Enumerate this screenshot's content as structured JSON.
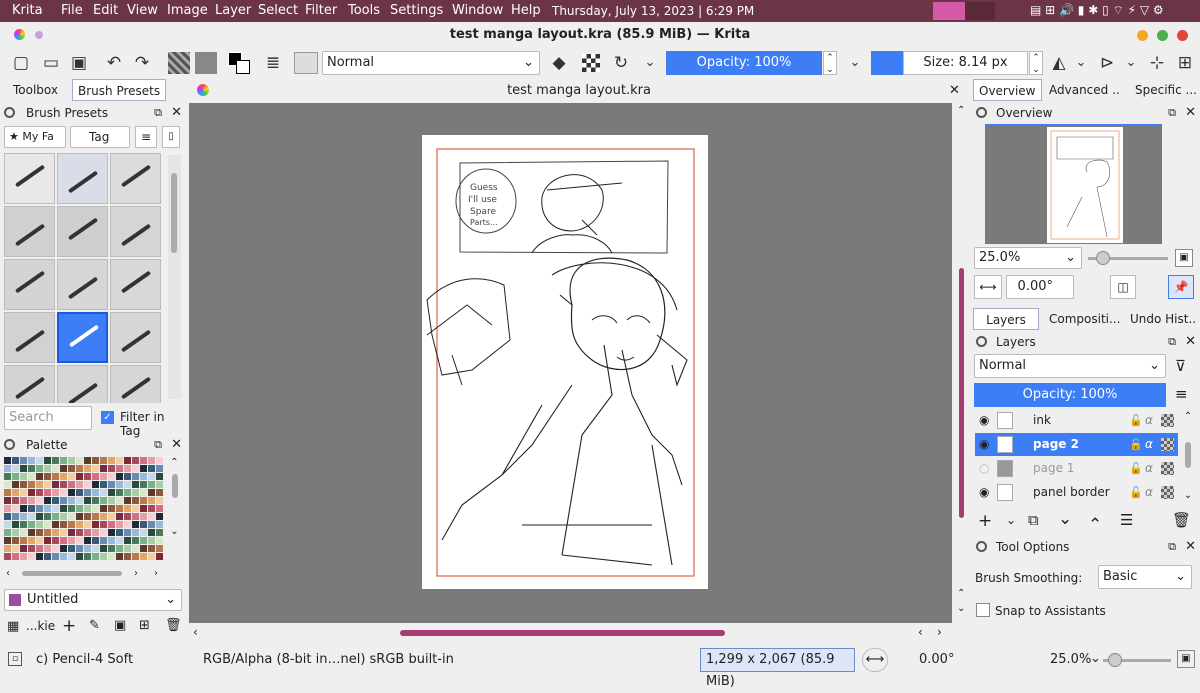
{
  "system_bar": {
    "app_menu": "Krita",
    "menus": [
      "File",
      "Edit",
      "View",
      "Image",
      "Layer",
      "Select",
      "Filter",
      "Tools",
      "Settings",
      "Window",
      "Help"
    ],
    "datetime": "Thursday, July 13, 2023 | 6:29 PM"
  },
  "window": {
    "title": "test manga layout.kra (85.9 MiB) — Krita"
  },
  "toolbar": {
    "blend_mode": "Normal",
    "opacity": "Opacity: 100%",
    "size": "Size: 8.14 px"
  },
  "left_dock": {
    "tabs": [
      "Toolbox",
      "Brush Presets"
    ],
    "brush_presets_title": "Brush Presets",
    "tag_filter": "★ My Fa",
    "tag_label": "Tag",
    "search_placeholder": "Search",
    "filter_in_tag": "Filter in Tag",
    "palette_title": "Palette",
    "palette_name": "Untitled",
    "palette_short": "...kie"
  },
  "document_tab": {
    "title": "test manga layout.kra"
  },
  "right_dock": {
    "top_tabs": [
      "Overview",
      "Advanced ...",
      "Specific ..."
    ],
    "overview_title": "Overview",
    "zoom": "25.0%",
    "rotation": "0.00°",
    "mid_tabs": [
      "Layers",
      "Compositi...",
      "Undo Hist..."
    ],
    "layers_title": "Layers",
    "layer_blend": "Normal",
    "layer_opacity": "Opacity:  100%",
    "layers": [
      {
        "name": "ink",
        "visible": true,
        "active": false
      },
      {
        "name": "page 2",
        "visible": true,
        "active": true
      },
      {
        "name": "page 1",
        "visible": false,
        "active": false
      },
      {
        "name": "panel border",
        "visible": true,
        "active": false
      }
    ],
    "tool_options_title": "Tool Options",
    "brush_smoothing_label": "Brush Smoothing:",
    "brush_smoothing_value": "Basic",
    "snap_label": "Snap to Assistants"
  },
  "comic_text": [
    "Guess",
    "I'll use",
    "Spare",
    "Parts..."
  ],
  "status": {
    "brush": "c) Pencil-4 Soft",
    "color_model": "RGB/Alpha (8-bit in…nel)  sRGB built-in",
    "dims": "1,299 x 2,067 (85.9 MiB)",
    "rotation": "0.00°",
    "zoom": "25.0%"
  },
  "colors": {
    "accent": "#3d7df5",
    "system_bar": "#6b3547",
    "scroll_accent": "#a53c74",
    "page_border": "#e07050"
  }
}
